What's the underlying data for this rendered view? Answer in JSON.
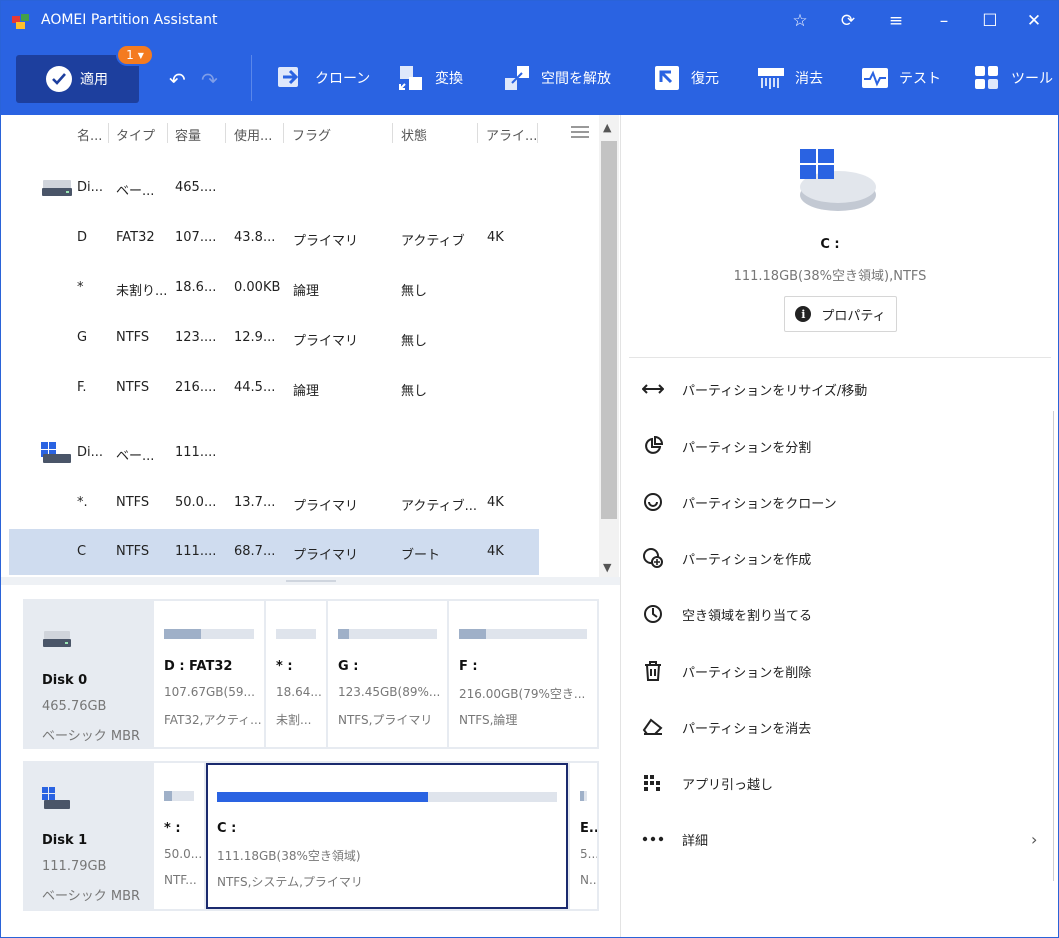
{
  "app": {
    "title": "AOMEI Partition Assistant"
  },
  "toolbar": {
    "apply_label": "適用",
    "pending_count": "1",
    "buttons": [
      {
        "label": "クローン"
      },
      {
        "label": "変換"
      },
      {
        "label": "空間を解放"
      },
      {
        "label": "復元"
      },
      {
        "label": "消去"
      },
      {
        "label": "テスト"
      },
      {
        "label": "ツール"
      }
    ]
  },
  "table": {
    "headers": [
      "名...",
      "タイプ",
      "容量",
      "使用...",
      "フラグ",
      "状態",
      "アライ..."
    ],
    "rows": [
      {
        "name": "Di...",
        "type": "ベー...",
        "capacity": "465....",
        "used": "",
        "flag": "",
        "status": "",
        "align": ""
      },
      {
        "name": "D",
        "type": "FAT32",
        "capacity": "107....",
        "used": "43.8...",
        "flag": "プライマリ",
        "status": "アクティブ",
        "align": "4K"
      },
      {
        "name": "*",
        "type": "未割り...",
        "capacity": "18.6...",
        "used": "0.00KB",
        "flag": "論理",
        "status": "無し",
        "align": ""
      },
      {
        "name": "G",
        "type": "NTFS",
        "capacity": "123....",
        "used": "12.9...",
        "flag": "プライマリ",
        "status": "無し",
        "align": ""
      },
      {
        "name": "F.",
        "type": "NTFS",
        "capacity": "216....",
        "used": "44.5...",
        "flag": "論理",
        "status": "無し",
        "align": ""
      },
      {
        "name": "Di...",
        "type": "ベー...",
        "capacity": "111....",
        "used": "",
        "flag": "",
        "status": "",
        "align": ""
      },
      {
        "name": "*.",
        "type": "NTFS",
        "capacity": "50.0...",
        "used": "13.7...",
        "flag": "プライマリ",
        "status": "アクティブ...",
        "align": "4K"
      },
      {
        "name": "C",
        "type": "NTFS",
        "capacity": "111....",
        "used": "68.7...",
        "flag": "プライマリ",
        "status": "ブート",
        "align": "4K"
      }
    ]
  },
  "disks": [
    {
      "name": "Disk 0",
      "size": "465.76GB",
      "type": "ベーシック MBR",
      "partitions": [
        {
          "name": "D : FAT32",
          "size": "107.67GB(59...",
          "fs": "FAT32,アクティ...",
          "used_fraction": 0.41
        },
        {
          "name": "* :",
          "size": "18.64...",
          "fs": "未割...",
          "used_fraction": 0.0
        },
        {
          "name": "G :",
          "size": "123.45GB(89%...",
          "fs": "NTFS,プライマリ",
          "used_fraction": 0.11
        },
        {
          "name": "F :",
          "size": "216.00GB(79%空き...",
          "fs": "NTFS,論理",
          "used_fraction": 0.21
        }
      ]
    },
    {
      "name": "Disk 1",
      "size": "111.79GB",
      "type": "ベーシック MBR",
      "partitions": [
        {
          "name": "* :",
          "size": "50.0...",
          "fs": "NTF...",
          "used_fraction": 0.27
        },
        {
          "name": "C :",
          "size": "111.18GB(38%空き領域)",
          "fs": "NTFS,システム,プライマリ",
          "used_fraction": 0.62
        },
        {
          "name": "E...",
          "size": "5...",
          "fs": "N...",
          "used_fraction": 0.5
        }
      ]
    }
  ],
  "details": {
    "name": "C :",
    "info": "111.18GB(38%空き領域),NTFS",
    "properties_label": "プロパティ"
  },
  "operations": [
    {
      "label": "パーティションをリサイズ/移動",
      "icon": "resize-move-icon"
    },
    {
      "label": "パーティションを分割",
      "icon": "split-icon"
    },
    {
      "label": "パーティションをクローン",
      "icon": "clone-partition-icon"
    },
    {
      "label": "パーティションを作成",
      "icon": "create-partition-icon"
    },
    {
      "label": "空き領域を割り当てる",
      "icon": "allocate-space-icon"
    },
    {
      "label": "パーティションを削除",
      "icon": "trash-icon"
    },
    {
      "label": "パーティションを消去",
      "icon": "eraser-icon"
    },
    {
      "label": "アプリ引っ越し",
      "icon": "app-mover-icon"
    },
    {
      "label": "詳細",
      "icon": "more-icon"
    }
  ],
  "colors": {
    "accent": "#2a63e2",
    "apply_bg": "#1d3f9e",
    "badge": "#f47b20",
    "selected_row": "#cfdcef"
  }
}
